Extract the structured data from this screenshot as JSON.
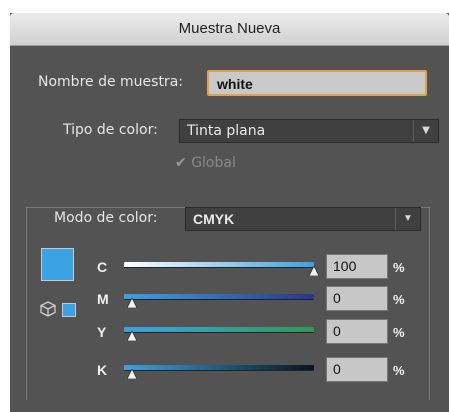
{
  "dialog": {
    "title": "Muestra Nueva",
    "swatch_name_label": "Nombre de muestra:",
    "swatch_name_value": "white",
    "color_type_label": "Tipo de color:",
    "color_type_value": "Tinta plana",
    "global_label": "Global",
    "global_checked": true,
    "color_mode_label": "Modo de color:",
    "color_mode_value": "CMYK",
    "swatch_color": "#3ba2e3",
    "channels": [
      {
        "letter": "C",
        "value": "100",
        "unit": "%",
        "fraction": 1.0
      },
      {
        "letter": "M",
        "value": "0",
        "unit": "%",
        "fraction": 0.0
      },
      {
        "letter": "Y",
        "value": "0",
        "unit": "%",
        "fraction": 0.0
      },
      {
        "letter": "K",
        "value": "0",
        "unit": "%",
        "fraction": 0.0
      }
    ]
  }
}
